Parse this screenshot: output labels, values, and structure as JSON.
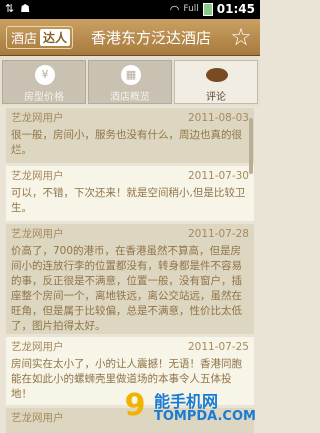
{
  "status_bar": {
    "signal_label": "Full",
    "time": "01:45",
    "icons": [
      "usb-icon",
      "debug-icon",
      "wifi-icon",
      "battery-icon"
    ]
  },
  "header": {
    "brand_text": "酒店",
    "brand_badge": "达人",
    "title": "香港东方泛达酒店",
    "favorite_icon": "star-icon"
  },
  "tabs": [
    {
      "label": "房型价格",
      "icon": "price-tag-icon",
      "active": false
    },
    {
      "label": "酒店概览",
      "icon": "hotel-overview-icon",
      "active": false
    },
    {
      "label": "评论",
      "icon": "comment-bubble-icon",
      "active": true
    }
  ],
  "reviews": [
    {
      "user": "艺龙网用户",
      "date": "2011-08-03",
      "text": "很一般，房间小，服务也没有什么，周边也真的很烂。"
    },
    {
      "user": "艺龙网用户",
      "date": "2011-07-30",
      "text": "可以，不错，下次还来！就是空间稍小,但是比较卫生。"
    },
    {
      "user": "艺龙网用户",
      "date": "2011-07-28",
      "text": "价高了，700的港币，在香港虽然不算高，但是房间小的连放行李的位置都没有，转身都是件不容易的事，反正很是不满意，位置一般，没有窗户，插座整个房间一个，离地铁远，离公交站远，虽然在旺角，但是属于比较偏，总是不满意，性价比太低了，图片拍得太好。"
    },
    {
      "user": "艺龙网用户",
      "date": "2011-07-25",
      "text": "房间实在太小了，小的让人震撼！无语！香港同胞能在如此小的螺蛳壳里做道场的本事令人五体投地！"
    },
    {
      "user": "艺龙网用户",
      "date": "",
      "text": ""
    }
  ],
  "watermark": {
    "cn": "能手机网",
    "en": "TOMPDA.COM"
  },
  "colors": {
    "header": "#b8894b",
    "review_text": "#8f7548",
    "review_dark_bg": "#ddd6c1",
    "review_light_bg": "#f7f4e8"
  }
}
